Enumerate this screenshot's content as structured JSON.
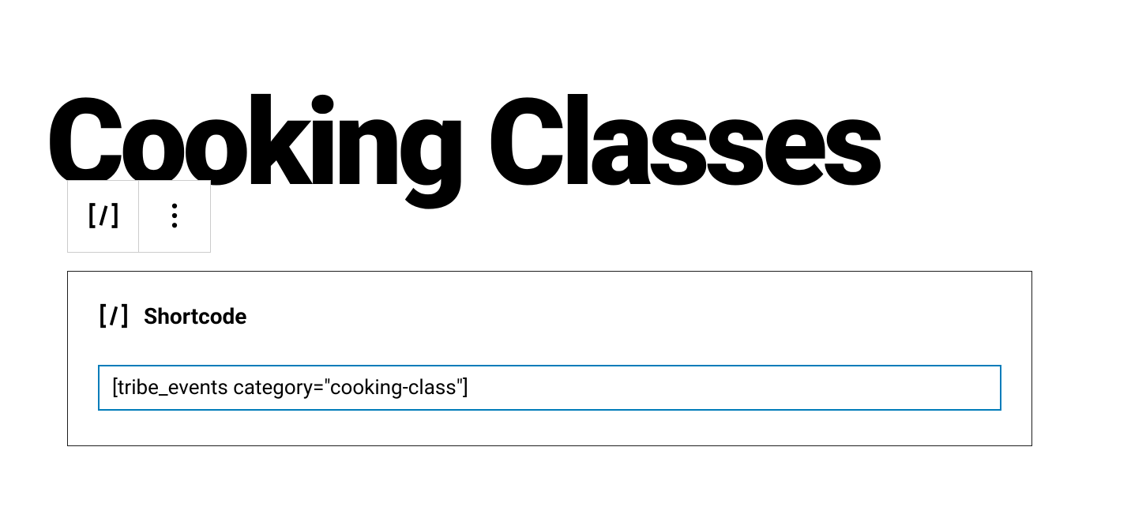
{
  "page": {
    "title": "Cooking Classes"
  },
  "toolbar": {
    "block_type_icon": "shortcode-icon",
    "more_options_icon": "more-vertical-icon"
  },
  "block": {
    "header_icon": "shortcode-icon",
    "label": "Shortcode",
    "input_value": "[tribe_events category=\"cooking-class\"]"
  }
}
